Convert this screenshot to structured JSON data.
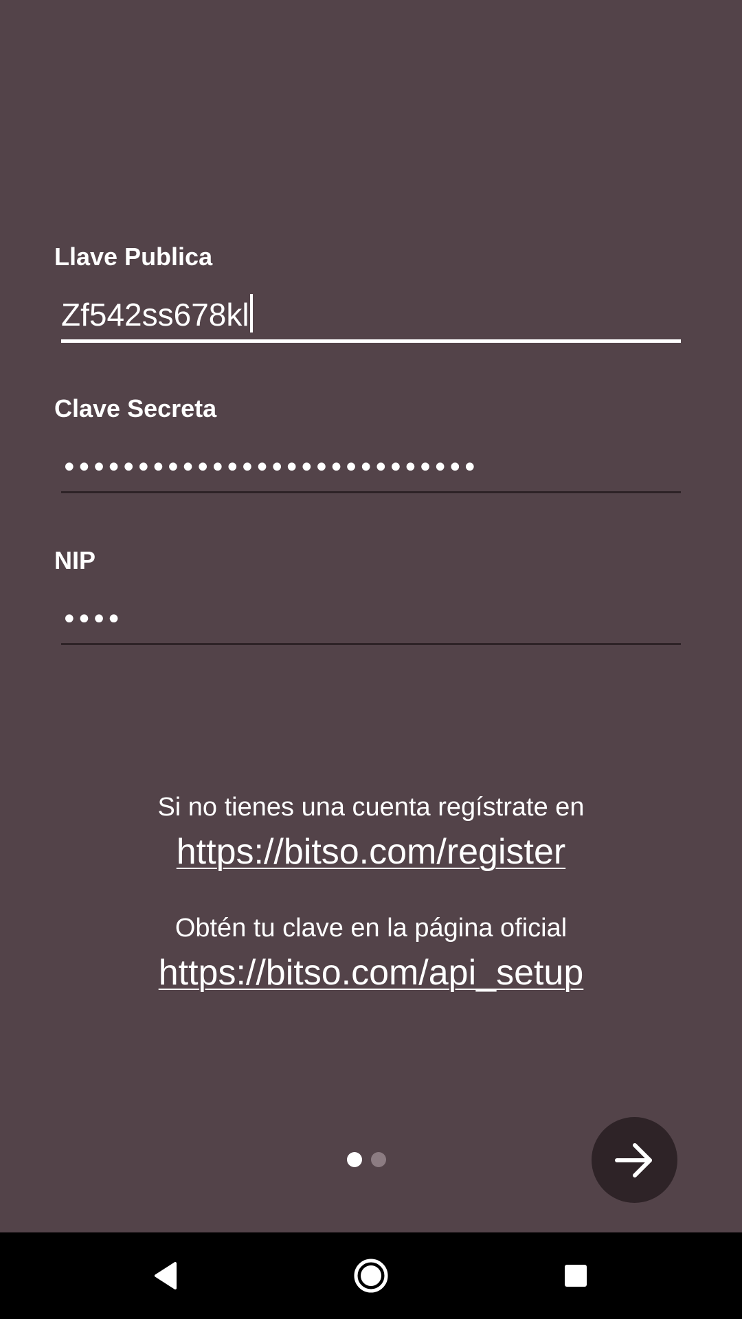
{
  "form": {
    "public_key": {
      "label": "Llave Publica",
      "value": "Zf542ss678kl"
    },
    "secret_key": {
      "label": "Clave Secreta",
      "value": "••••••••••••••••••••••••••••"
    },
    "pin": {
      "label": "NIP",
      "value": "••••"
    }
  },
  "info": {
    "register_text": "Si no tienes una cuenta regístrate en",
    "register_link": "https://bitso.com/register",
    "api_text": "Obtén tu clave en la página oficial",
    "api_link": "https://bitso.com/api_setup"
  },
  "pager": {
    "pages": 2,
    "current": 1
  },
  "icons": {
    "next": "arrow-right-icon",
    "back": "back-triangle-icon",
    "home": "home-circle-icon",
    "recents": "recents-square-icon"
  },
  "colors": {
    "background": "#534349",
    "accent_dark": "#2e2327",
    "text": "#ffffff",
    "navbar": "#000000"
  }
}
